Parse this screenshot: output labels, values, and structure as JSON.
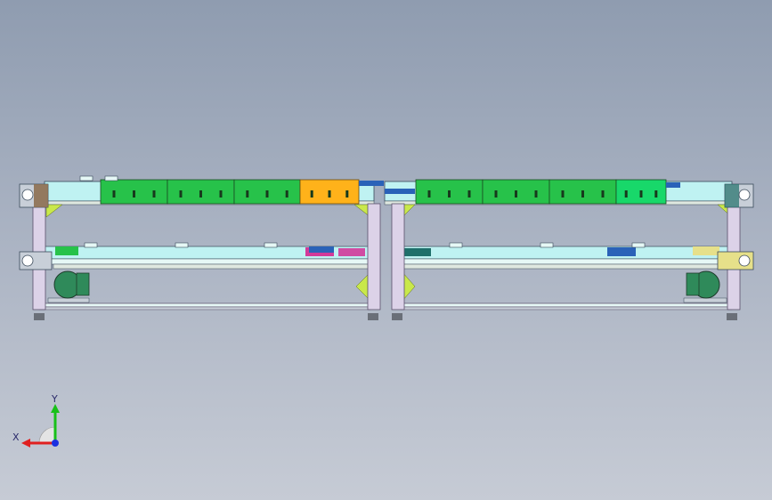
{
  "viewport": {
    "background_top": "#8f9cb0",
    "background_bottom": "#c6cbd5"
  },
  "model": {
    "description_icon": "conveyor-assembly-model",
    "colors": {
      "frame": "#dcd2e8",
      "frame_edge": "#5a4f6a",
      "rail_cyan": "#bff2f2",
      "rail_light": "#e6f8f6",
      "bracket_lime": "#c9e84a",
      "panel_green": "#27c24a",
      "panel_green_light": "#18d86a",
      "panel_orange": "#ffb21a",
      "motor_green": "#2f8a5a",
      "blue_block": "#2a62b8",
      "magenta_block": "#d23a9a",
      "teal_block": "#1f6f6a",
      "brown_plate": "#8a6a4a",
      "plate_gray": "#c8cfd8",
      "yellow_plate": "#e6e08a"
    }
  },
  "triad": {
    "y_label": "Y",
    "x_label": "X",
    "y_color": "#18c018",
    "x_color": "#e02020",
    "z_color": "#1a30e0"
  }
}
